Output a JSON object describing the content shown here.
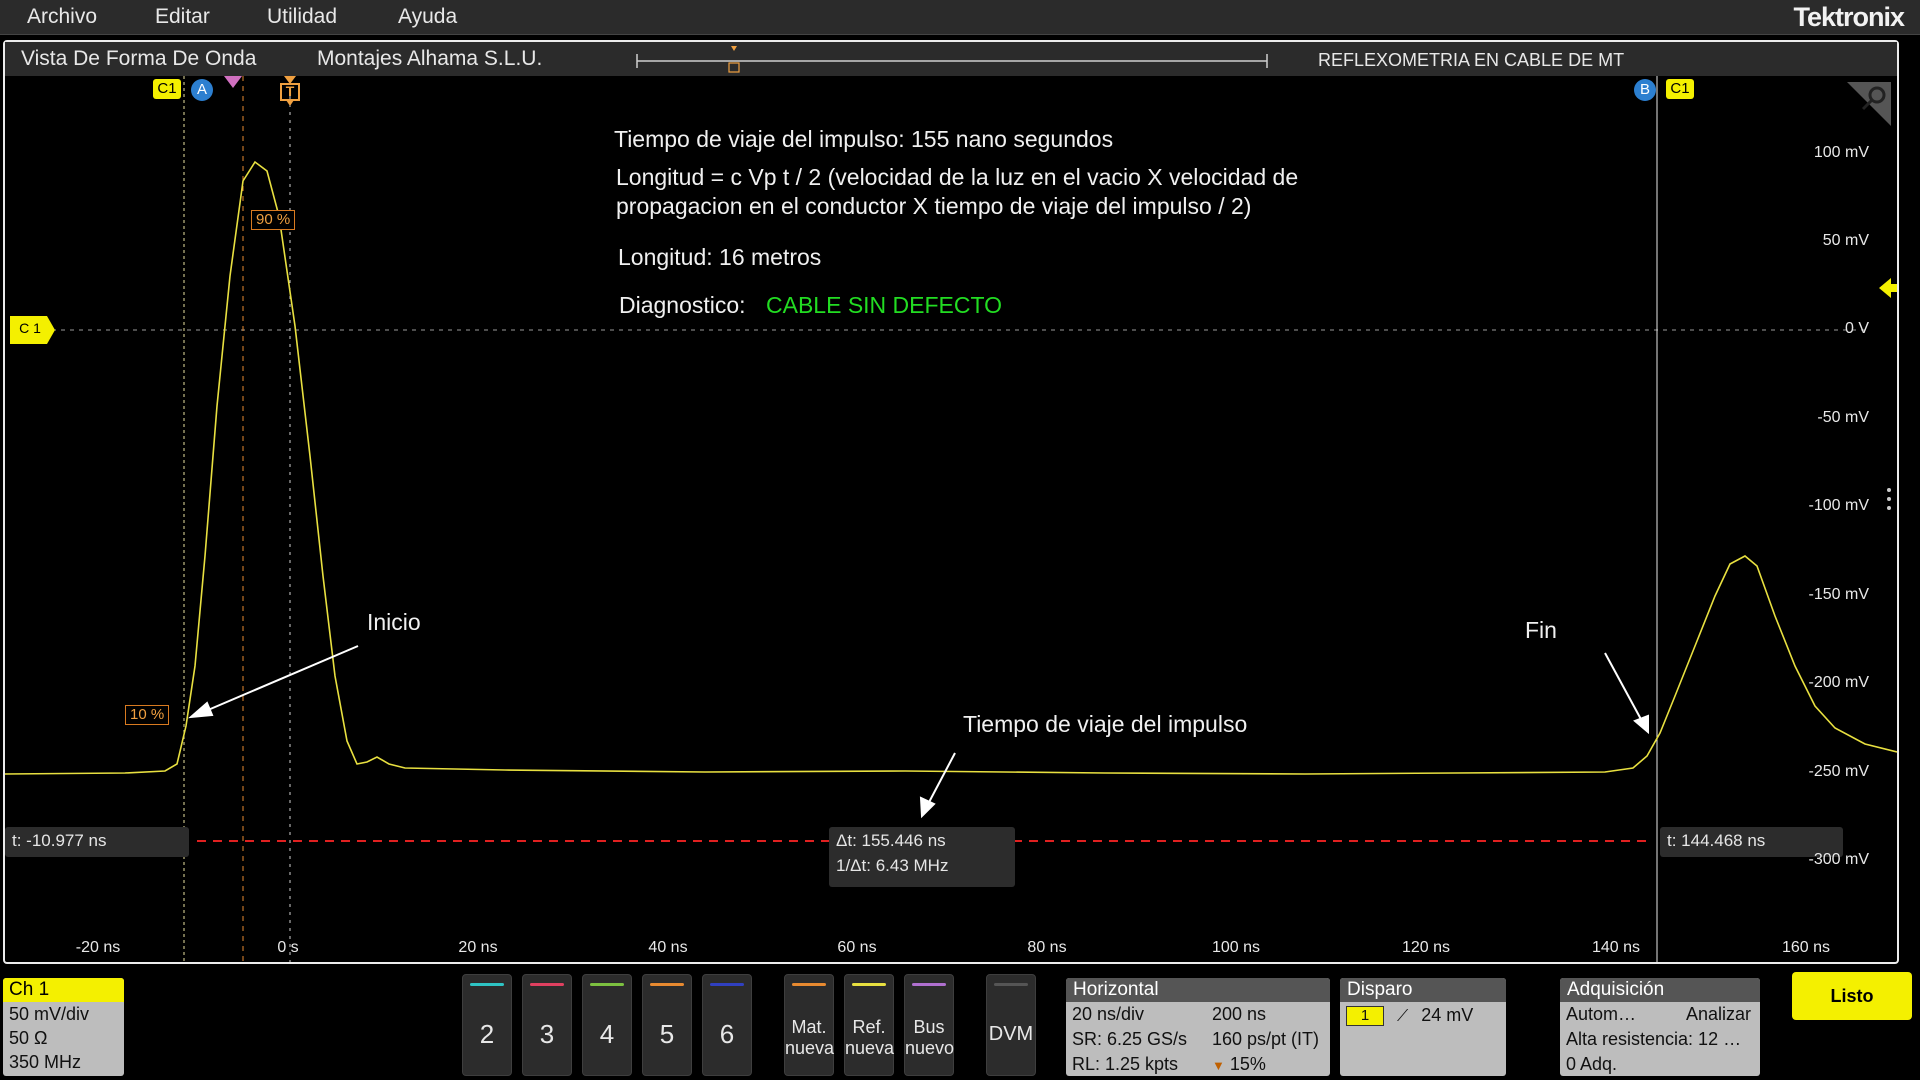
{
  "menu": {
    "items": [
      "Archivo",
      "Editar",
      "Utilidad",
      "Ayuda"
    ],
    "brand": "Tektronix"
  },
  "titlebar": {
    "view_title": "Vista De Forma De Onda",
    "company": "Montajes Alhama S.L.U.",
    "record_title": "REFLEXOMETRIA EN CABLE DE MT"
  },
  "annotations": {
    "travel_time": "Tiempo de viaje del impulso: 155 nano segundos",
    "formula_line1": "Longitud = c Vp t / 2 (velocidad de la luz en el vacio X velocidad de",
    "formula_line2": "propagacion en el conductor X tiempo de viaje del impulso / 2)",
    "length": "Longitud: 16 metros",
    "diagnostic_label": "Diagnostico:",
    "diagnostic_value": "CABLE SIN DEFECTO",
    "start_label": "Inicio",
    "end_label": "Fin",
    "travel_label": "Tiempo de viaje del impulso"
  },
  "markers": {
    "c1": "C1",
    "a": "A",
    "b": "B",
    "trigger": "T",
    "ch_ground": "C 1",
    "pct_90": "90 %",
    "pct_10": "10 %"
  },
  "cursors": {
    "a_time": "t: -10.977 ns",
    "b_time": "t: 144.468 ns",
    "delta_t": "Δt: 155.446 ns",
    "inv_delta_t": "1/Δt: 6.43 MHz"
  },
  "y_axis": [
    "100 mV",
    "50 mV",
    "0 V",
    "-50 mV",
    "-100 mV",
    "-150 mV",
    "-200 mV",
    "-250 mV",
    "-300 mV"
  ],
  "x_axis": [
    "-20 ns",
    "0 s",
    "20 ns",
    "40 ns",
    "60 ns",
    "80 ns",
    "100 ns",
    "120 ns",
    "140 ns",
    "160 ns"
  ],
  "ch1": {
    "title": "Ch 1",
    "scale": "50 mV/div",
    "impedance": "50 Ω",
    "bandwidth": "350 MHz"
  },
  "channel_buttons": [
    {
      "label": "2",
      "color": "#2ec4c4"
    },
    {
      "label": "3",
      "color": "#e04060"
    },
    {
      "label": "4",
      "color": "#7cc040"
    },
    {
      "label": "5",
      "color": "#e88a30"
    },
    {
      "label": "6",
      "color": "#3040c0"
    }
  ],
  "new_buttons": [
    {
      "line1": "Mat.",
      "line2": "nueva",
      "color": "#e88a30"
    },
    {
      "line1": "Ref.",
      "line2": "nueva",
      "color": "#e8e040"
    },
    {
      "line1": "Bus",
      "line2": "nuevo",
      "color": "#b070d0"
    }
  ],
  "dvm_label": "DVM",
  "horizontal": {
    "title": "Horizontal",
    "scale": "20 ns/div",
    "position": "200 ns",
    "sample_rate": "SR: 6.25 GS/s",
    "resolution": "160 ps/pt (IT)",
    "record_length": "RL: 1.25 kpts",
    "trigger_pos": "15%"
  },
  "trigger": {
    "title": "Disparo",
    "source": "1",
    "level": "24 mV"
  },
  "acquisition": {
    "title": "Adquisición",
    "mode": "Autom…",
    "action": "Analizar",
    "resolution": "Alta resistencia: 12 …",
    "count": "0 Adq."
  },
  "status": "Listo",
  "colors": {
    "waveform": "#e8e040",
    "cursor_line": "#e02020",
    "trigger": "#f0a040",
    "ch1_yellow": "#f4f000"
  }
}
